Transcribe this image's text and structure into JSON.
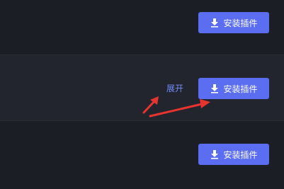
{
  "plugins": [
    {
      "install_label": "安装插件"
    },
    {
      "install_label": "安装插件",
      "expand_label": "展开"
    },
    {
      "install_label": "安装插件"
    }
  ],
  "colors": {
    "background": "#1b1e25",
    "highlight_row": "#22252d",
    "button": "#5b6df0",
    "link": "#6f8cf5",
    "annotation_arrow": "#e8342f"
  },
  "icons": {
    "install": "download-icon"
  }
}
